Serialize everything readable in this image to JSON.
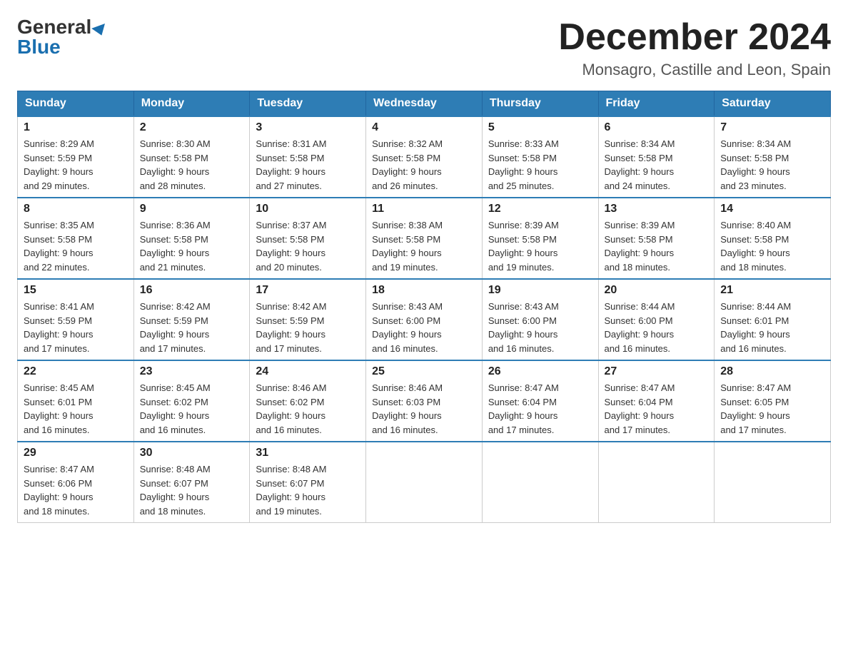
{
  "header": {
    "logo_general": "General",
    "logo_blue": "Blue",
    "month_title": "December 2024",
    "location": "Monsagro, Castille and Leon, Spain"
  },
  "weekdays": [
    "Sunday",
    "Monday",
    "Tuesday",
    "Wednesday",
    "Thursday",
    "Friday",
    "Saturday"
  ],
  "weeks": [
    [
      {
        "day": "1",
        "sunrise": "8:29 AM",
        "sunset": "5:59 PM",
        "daylight": "9 hours and 29 minutes."
      },
      {
        "day": "2",
        "sunrise": "8:30 AM",
        "sunset": "5:58 PM",
        "daylight": "9 hours and 28 minutes."
      },
      {
        "day": "3",
        "sunrise": "8:31 AM",
        "sunset": "5:58 PM",
        "daylight": "9 hours and 27 minutes."
      },
      {
        "day": "4",
        "sunrise": "8:32 AM",
        "sunset": "5:58 PM",
        "daylight": "9 hours and 26 minutes."
      },
      {
        "day": "5",
        "sunrise": "8:33 AM",
        "sunset": "5:58 PM",
        "daylight": "9 hours and 25 minutes."
      },
      {
        "day": "6",
        "sunrise": "8:34 AM",
        "sunset": "5:58 PM",
        "daylight": "9 hours and 24 minutes."
      },
      {
        "day": "7",
        "sunrise": "8:34 AM",
        "sunset": "5:58 PM",
        "daylight": "9 hours and 23 minutes."
      }
    ],
    [
      {
        "day": "8",
        "sunrise": "8:35 AM",
        "sunset": "5:58 PM",
        "daylight": "9 hours and 22 minutes."
      },
      {
        "day": "9",
        "sunrise": "8:36 AM",
        "sunset": "5:58 PM",
        "daylight": "9 hours and 21 minutes."
      },
      {
        "day": "10",
        "sunrise": "8:37 AM",
        "sunset": "5:58 PM",
        "daylight": "9 hours and 20 minutes."
      },
      {
        "day": "11",
        "sunrise": "8:38 AM",
        "sunset": "5:58 PM",
        "daylight": "9 hours and 19 minutes."
      },
      {
        "day": "12",
        "sunrise": "8:39 AM",
        "sunset": "5:58 PM",
        "daylight": "9 hours and 19 minutes."
      },
      {
        "day": "13",
        "sunrise": "8:39 AM",
        "sunset": "5:58 PM",
        "daylight": "9 hours and 18 minutes."
      },
      {
        "day": "14",
        "sunrise": "8:40 AM",
        "sunset": "5:58 PM",
        "daylight": "9 hours and 18 minutes."
      }
    ],
    [
      {
        "day": "15",
        "sunrise": "8:41 AM",
        "sunset": "5:59 PM",
        "daylight": "9 hours and 17 minutes."
      },
      {
        "day": "16",
        "sunrise": "8:42 AM",
        "sunset": "5:59 PM",
        "daylight": "9 hours and 17 minutes."
      },
      {
        "day": "17",
        "sunrise": "8:42 AM",
        "sunset": "5:59 PM",
        "daylight": "9 hours and 17 minutes."
      },
      {
        "day": "18",
        "sunrise": "8:43 AM",
        "sunset": "6:00 PM",
        "daylight": "9 hours and 16 minutes."
      },
      {
        "day": "19",
        "sunrise": "8:43 AM",
        "sunset": "6:00 PM",
        "daylight": "9 hours and 16 minutes."
      },
      {
        "day": "20",
        "sunrise": "8:44 AM",
        "sunset": "6:00 PM",
        "daylight": "9 hours and 16 minutes."
      },
      {
        "day": "21",
        "sunrise": "8:44 AM",
        "sunset": "6:01 PM",
        "daylight": "9 hours and 16 minutes."
      }
    ],
    [
      {
        "day": "22",
        "sunrise": "8:45 AM",
        "sunset": "6:01 PM",
        "daylight": "9 hours and 16 minutes."
      },
      {
        "day": "23",
        "sunrise": "8:45 AM",
        "sunset": "6:02 PM",
        "daylight": "9 hours and 16 minutes."
      },
      {
        "day": "24",
        "sunrise": "8:46 AM",
        "sunset": "6:02 PM",
        "daylight": "9 hours and 16 minutes."
      },
      {
        "day": "25",
        "sunrise": "8:46 AM",
        "sunset": "6:03 PM",
        "daylight": "9 hours and 16 minutes."
      },
      {
        "day": "26",
        "sunrise": "8:47 AM",
        "sunset": "6:04 PM",
        "daylight": "9 hours and 17 minutes."
      },
      {
        "day": "27",
        "sunrise": "8:47 AM",
        "sunset": "6:04 PM",
        "daylight": "9 hours and 17 minutes."
      },
      {
        "day": "28",
        "sunrise": "8:47 AM",
        "sunset": "6:05 PM",
        "daylight": "9 hours and 17 minutes."
      }
    ],
    [
      {
        "day": "29",
        "sunrise": "8:47 AM",
        "sunset": "6:06 PM",
        "daylight": "9 hours and 18 minutes."
      },
      {
        "day": "30",
        "sunrise": "8:48 AM",
        "sunset": "6:07 PM",
        "daylight": "9 hours and 18 minutes."
      },
      {
        "day": "31",
        "sunrise": "8:48 AM",
        "sunset": "6:07 PM",
        "daylight": "9 hours and 19 minutes."
      },
      null,
      null,
      null,
      null
    ]
  ],
  "labels": {
    "sunrise": "Sunrise:",
    "sunset": "Sunset:",
    "daylight": "Daylight:"
  }
}
